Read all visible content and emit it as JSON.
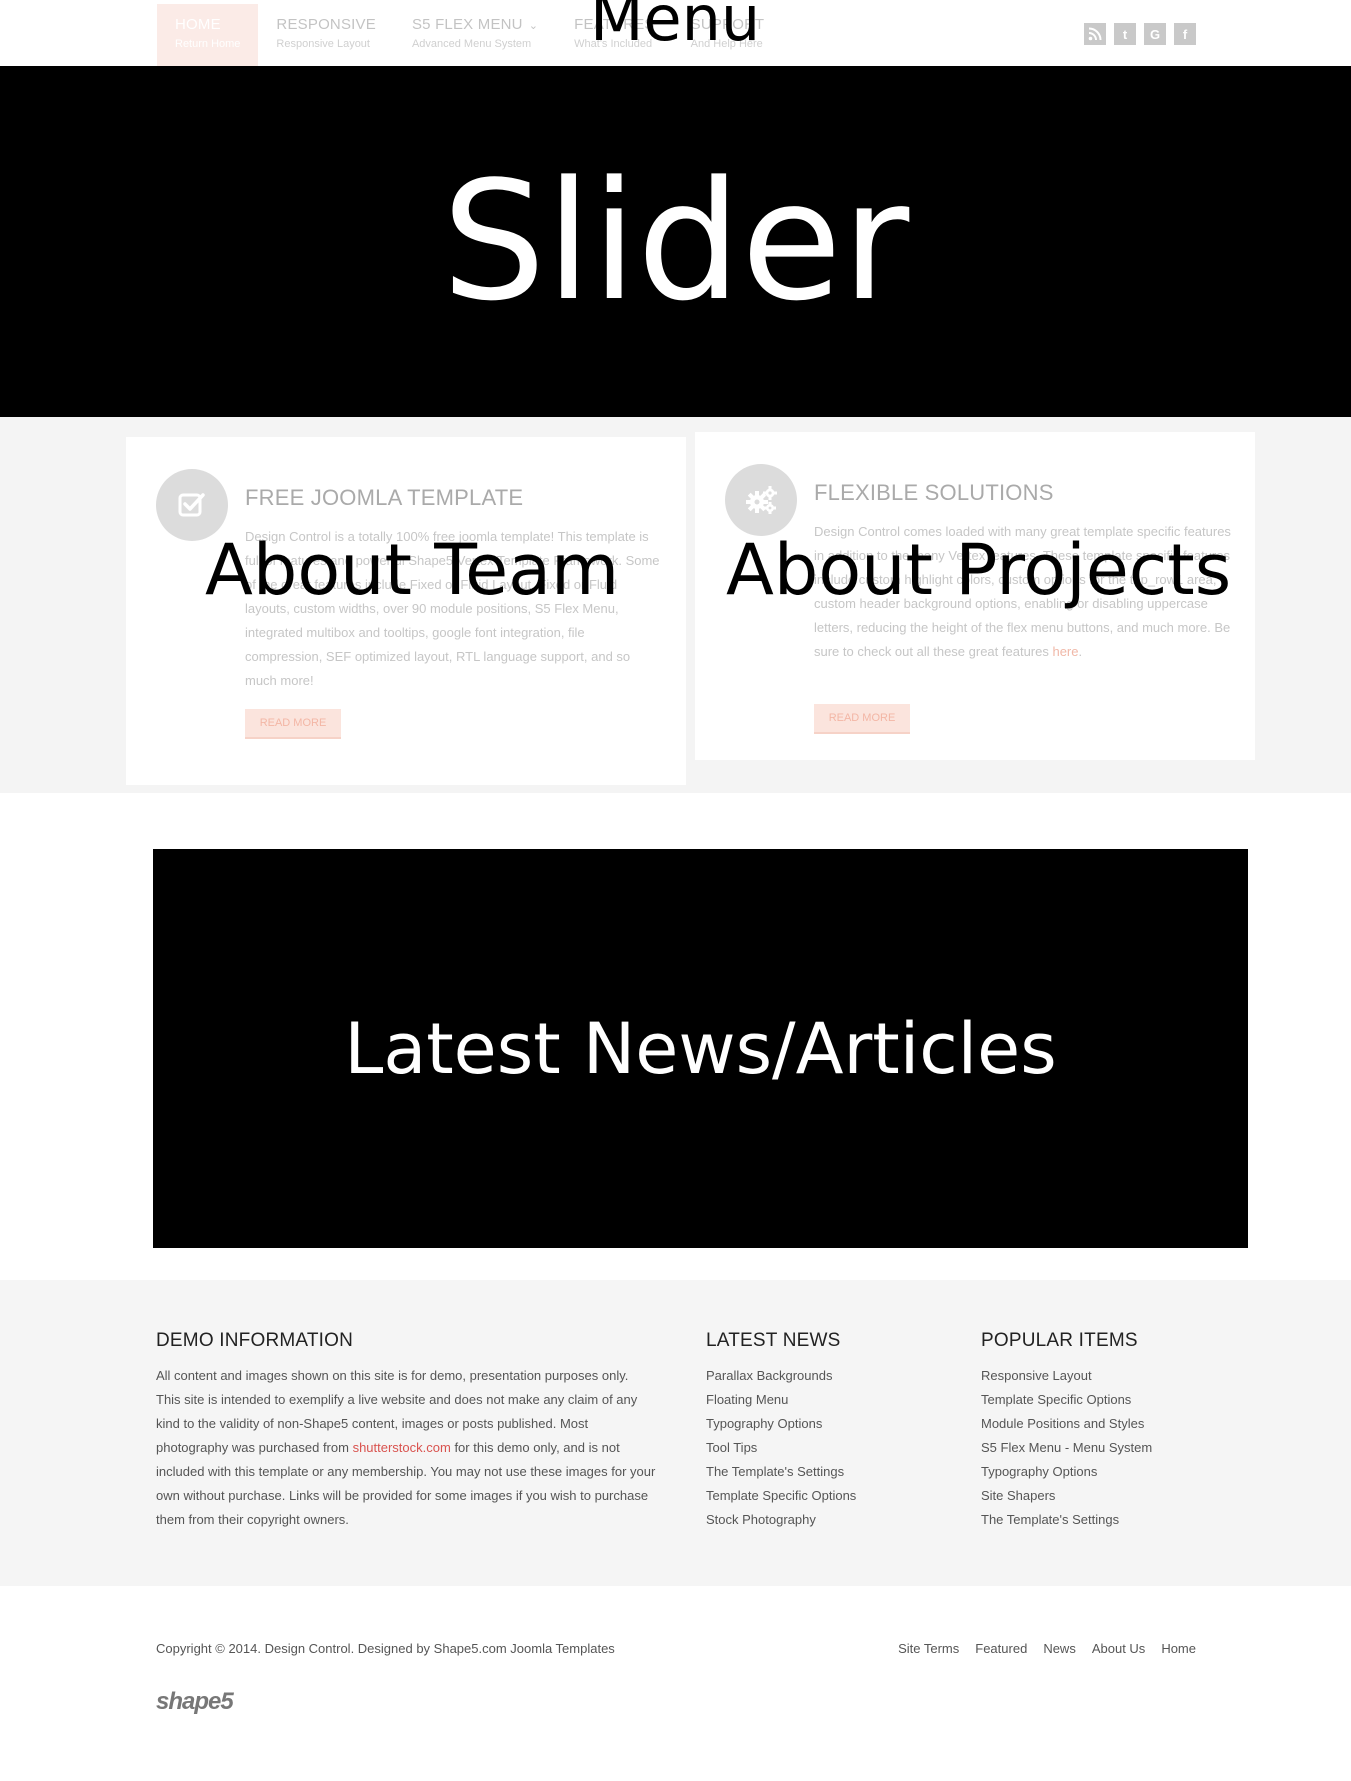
{
  "header": {
    "menu": [
      {
        "label": "HOME",
        "sub": "Return Home"
      },
      {
        "label": "RESPONSIVE",
        "sub": "Responsive Layout"
      },
      {
        "label": "S5 FLEX MENU",
        "sub": "Advanced Menu System"
      },
      {
        "label": "FEATURES",
        "sub": "What's Included"
      },
      {
        "label": "SUPPORT",
        "sub": "And Help Here"
      }
    ],
    "overlay_label": "Menu",
    "social_icons": [
      "rss-icon",
      "twitter-icon",
      "google-icon",
      "facebook-icon"
    ]
  },
  "slider": {
    "label": "Slider"
  },
  "features": {
    "box1": {
      "title": "FREE JOOMLA TEMPLATE",
      "body": "Design Control is a totally 100% free joomla template! This template is full of features and powerful Shape5 Vertex Template Framework. Some of the great features include Fixed or Fluid Layout, Fixed or Fluid layouts, custom widths, over 90 module positions, S5 Flex Menu, integrated multibox and tooltips, google font integration, file compression, SEF optimized layout, RTL language support, and so much more!",
      "button": "READ MORE",
      "overlay": "About Team",
      "icon": "checkbox-icon"
    },
    "box2": {
      "title": "FLEXIBLE SOLUTIONS",
      "body_before": "Design Control comes loaded with many great template specific features in addition to the many Vertex features. These template specific features include custom highlight colors, custom options for the top_row1 area, custom header background options, enabling or disabling uppercase letters, reducing the height of the flex menu buttons, and much more. Be sure to check out all these great features ",
      "body_link": "here",
      "body_after": ".",
      "button": "READ MORE",
      "overlay": "About Projects",
      "icon": "gears-icon"
    }
  },
  "news": {
    "label": "Latest News/Articles"
  },
  "bottom": {
    "demo": {
      "title": "DEMO INFORMATION",
      "text_before": "All content and images shown on this site is for demo, presentation purposes only. This site is intended to exemplify a live website and does not make any claim of any kind to the validity of non-Shape5 content, images or posts published. Most photography was purchased from ",
      "link": "shutterstock.com",
      "text_after": " for this demo only, and is not included with this template or any membership. You may not use these images for your own without purchase. Links will be provided for some images if you wish to purchase them from their copyright owners."
    },
    "latest_news": {
      "title": "LATEST NEWS",
      "items": [
        "Parallax Backgrounds",
        "Floating Menu",
        "Typography Options",
        "Tool Tips",
        "The Template's Settings",
        "Template Specific Options",
        "Stock Photography"
      ]
    },
    "popular_items": {
      "title": "POPULAR ITEMS",
      "items": [
        "Responsive Layout",
        "Template Specific Options",
        "Module Positions and Styles",
        "S5 Flex Menu - Menu System",
        "Typography Options",
        "Site Shapers",
        "The Template's Settings"
      ]
    }
  },
  "footer": {
    "copyright": "Copyright © 2014. Design Control. Designed by Shape5.com Joomla Templates",
    "links": [
      "Site Terms",
      "Featured",
      "News",
      "About Us",
      "Home"
    ],
    "logo": "shape5"
  },
  "colors": {
    "accent": "#f5c8bb",
    "link": "#d9534f",
    "panel_bg": "#f4f4f4"
  }
}
